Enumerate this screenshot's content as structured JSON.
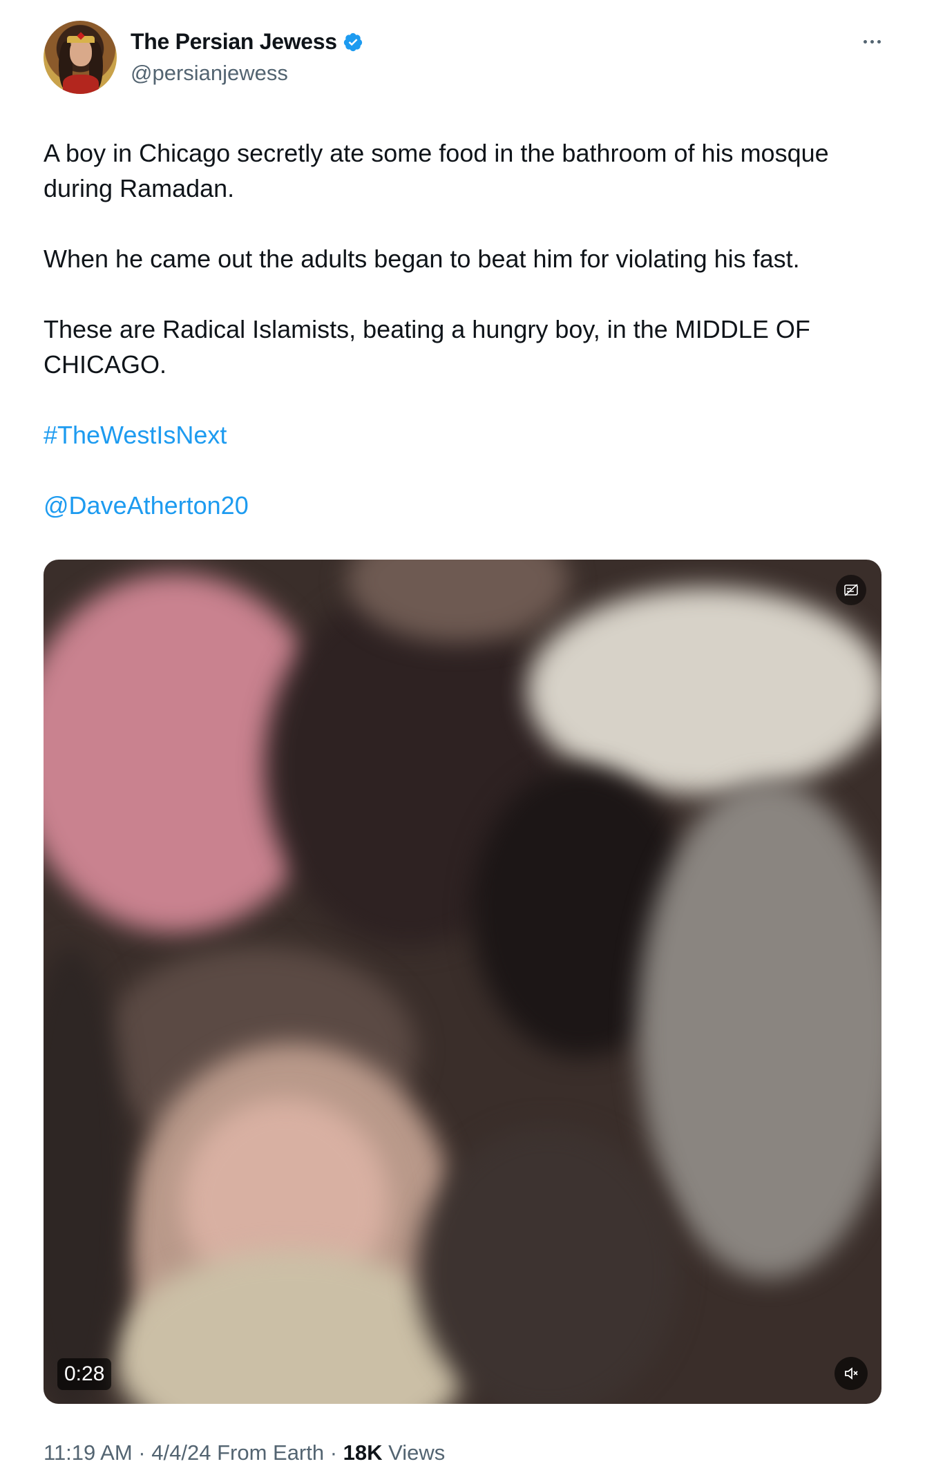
{
  "author": {
    "display_name": "The Persian Jewess",
    "handle": "@persianjewess",
    "verified": true,
    "avatar_icon": "avatar-portrait"
  },
  "tweet": {
    "paragraphs": [
      "A boy in Chicago secretly ate some food in the bathroom of his mosque during Ramadan.",
      "When he came out the adults began to beat him for violating his fast.",
      "These are Radical Islamists, beating a hungry boy, in the MIDDLE OF CHICAGO."
    ],
    "hashtag": "#TheWestIsNext",
    "mention": "@DaveAtherton20"
  },
  "media": {
    "type": "video",
    "duration": "0:28",
    "muted": true,
    "icons": [
      "gif-toggle-icon",
      "mute-icon"
    ]
  },
  "meta": {
    "time": "11:19 AM",
    "separator": " · ",
    "date": "4/4/24",
    "source": "From Earth",
    "views_count": "18K",
    "views_label": "Views"
  },
  "colors": {
    "link": "#1d9bf0",
    "verified": "#1d9bf0",
    "secondary_text": "#536471",
    "primary_text": "#0f1419"
  }
}
